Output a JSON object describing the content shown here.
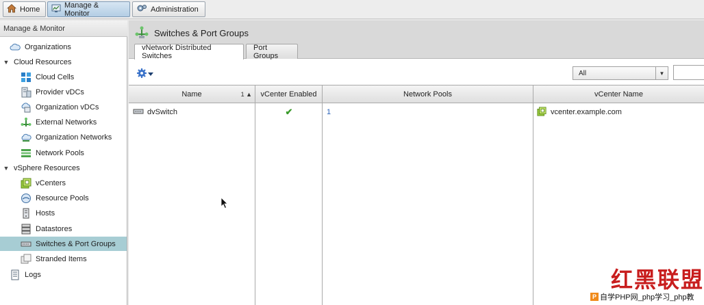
{
  "top_tabs": [
    {
      "label": "Home",
      "icon": "home-icon"
    },
    {
      "label": "Manage & Monitor",
      "icon": "monitor-icon",
      "active": true
    },
    {
      "label": "Administration",
      "icon": "administration-icon"
    }
  ],
  "sidebar": {
    "title": "Manage & Monitor",
    "items": [
      {
        "label": "Organizations",
        "icon": "cloud-icon"
      },
      {
        "label": "Cloud Resources",
        "group": true
      },
      {
        "label": "Cloud Cells",
        "icon": "cloud-cells-icon"
      },
      {
        "label": "Provider vDCs",
        "icon": "provider-vdc-icon"
      },
      {
        "label": "Organization vDCs",
        "icon": "organization-vdc-icon"
      },
      {
        "label": "External Networks",
        "icon": "external-network-icon"
      },
      {
        "label": "Organization Networks",
        "icon": "organization-network-icon"
      },
      {
        "label": "Network Pools",
        "icon": "network-pools-icon"
      },
      {
        "label": "vSphere Resources",
        "group": true
      },
      {
        "label": "vCenters",
        "icon": "vcenter-icon"
      },
      {
        "label": "Resource Pools",
        "icon": "resource-pool-icon"
      },
      {
        "label": "Hosts",
        "icon": "host-icon"
      },
      {
        "label": "Datastores",
        "icon": "datastore-icon"
      },
      {
        "label": "Switches & Port Groups",
        "icon": "switch-icon",
        "selected": true
      },
      {
        "label": "Stranded Items",
        "icon": "stranded-items-icon"
      },
      {
        "label": "Logs",
        "icon": "logs-icon"
      }
    ]
  },
  "main": {
    "title": "Switches & Port Groups",
    "tabs": [
      {
        "label": "vNetwork Distributed Switches",
        "active": true
      },
      {
        "label": "Port Groups"
      }
    ],
    "filter": {
      "selected": "All"
    },
    "columns": [
      "Name",
      "vCenter Enabled",
      "Network Pools",
      "vCenter Name"
    ],
    "sort_indicator": "1",
    "rows": [
      {
        "name": "dvSwitch",
        "vcenter_enabled": "✔",
        "network_pools": "1",
        "vcenter_name": "vcenter.example.com"
      }
    ]
  },
  "watermark": {
    "big_text": "红黑联盟",
    "small_text": "自学PHP网_php学习_php教",
    "logo_letter": "P"
  },
  "colors": {
    "selected_row": "#a7cdd4",
    "link": "#2a62b8",
    "check": "#3a9a2a",
    "watermark": "#c81e1e"
  }
}
